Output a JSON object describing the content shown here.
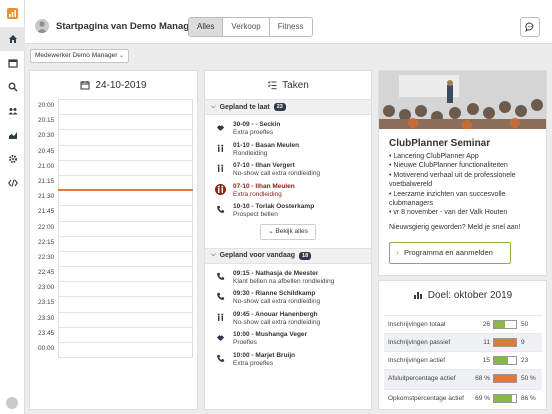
{
  "header": {
    "title": "Startpagina van Demo Manager",
    "tabs": [
      {
        "label": "Alles",
        "active": true
      },
      {
        "label": "Verkoop",
        "active": false
      },
      {
        "label": "Fitness",
        "active": false
      }
    ]
  },
  "sidebar": {
    "items": [
      {
        "icon": "home-icon",
        "active": true
      },
      {
        "icon": "calendar-icon",
        "active": false
      },
      {
        "icon": "search-icon",
        "active": false
      },
      {
        "icon": "users-icon",
        "active": false
      },
      {
        "icon": "chart-icon",
        "active": false
      },
      {
        "icon": "gear-icon",
        "active": false
      },
      {
        "icon": "code-icon",
        "active": false
      }
    ]
  },
  "employee_select": {
    "value": "Medewerker Demo Manager"
  },
  "calendar": {
    "date": "24-10-2019",
    "times": [
      "20:00",
      "20:15",
      "20:30",
      "20:45",
      "21:00",
      "21:15",
      "21:30",
      "21:45",
      "22:00",
      "22:15",
      "22:30",
      "22:45",
      "23:00",
      "23:15",
      "23:30",
      "23:45",
      "00:00"
    ],
    "now_after_slot": 5
  },
  "tasks": {
    "title": "Taken",
    "sections": [
      {
        "title": "Gepland te laat",
        "count": "23",
        "items": [
          {
            "title": "30-09 - - Seckin",
            "subtitle": "Extra proefles",
            "icon": "handshake-icon",
            "overdue": false
          },
          {
            "title": "01-10 - Basan Meulen",
            "subtitle": "Rondleiding",
            "icon": "walk-icon",
            "overdue": false
          },
          {
            "title": "07-10 - Ilhan Vergert",
            "subtitle": "No-show call extra rondleiding",
            "icon": "walk-icon",
            "overdue": false
          },
          {
            "title": "07-10 - Ilhan Meulen",
            "subtitle": "Extra rondleiding",
            "icon": "walk-icon",
            "overdue": true
          },
          {
            "title": "10-10 - Torlak Oosterkamp",
            "subtitle": "Prospect bellen",
            "icon": "phone-icon",
            "overdue": false
          }
        ],
        "show_all": "Bekijk alles"
      },
      {
        "title": "Gepland voor vandaag",
        "count": "18",
        "items": [
          {
            "title": "09:15 - Nathasja de Meester",
            "subtitle": "Klant bellen na afbellen rondleiding",
            "icon": "phone-icon",
            "overdue": false
          },
          {
            "title": "09:30 - Rianne Schildkamp",
            "subtitle": "No-show call extra rondleiding",
            "icon": "phone-icon",
            "overdue": false
          },
          {
            "title": "09:45 - Anouar Hanenbergh",
            "subtitle": "No-show call extra rondleiding",
            "icon": "walk-icon",
            "overdue": false
          },
          {
            "title": "10:00 - Mushanga Veger",
            "subtitle": "Proefles",
            "icon": "handshake-icon",
            "overdue": false
          },
          {
            "title": "10:00 - Marjet Bruijn",
            "subtitle": "Extra proefles",
            "icon": "phone-icon",
            "overdue": false
          }
        ]
      }
    ]
  },
  "seminar": {
    "title": "ClubPlanner Seminar",
    "bullets": [
      "• Lancering ClubPlanner App",
      "• Nieuwe ClubPlanner functionaliteiten",
      "• Motiverend verhaal uit de professionele voetbalwereld",
      "• Leerzame inzichten van succesvolle clubmanagers",
      "• vr 8 november - van der Valk Houten"
    ],
    "cta_text": "Nieuwsgierig geworden? Meld je snel aan!",
    "button_label": "Programma en aanmelden"
  },
  "goal": {
    "title": "Doel: oktober 2019",
    "rows": [
      {
        "label": "Inschrijvingen totaal",
        "current": "26",
        "target": "50",
        "fraction": 0.52,
        "color": "#8ab844"
      },
      {
        "label": "Inschrijvingen passief",
        "current": "11",
        "target": "9",
        "fraction": 1.0,
        "color": "#e07a3c"
      },
      {
        "label": "Inschrijvingen actief",
        "current": "15",
        "target": "23",
        "fraction": 0.65,
        "color": "#8ab844"
      },
      {
        "label": "Afsluitpercentage actief",
        "current": "68 %",
        "target": "50 %",
        "fraction": 1.0,
        "color": "#e07a3c"
      },
      {
        "label": "Opkomstpercentage actief",
        "current": "69 %",
        "target": "86 %",
        "fraction": 0.8,
        "color": "#8ab844"
      }
    ]
  },
  "colors": {
    "accent_green": "#87b43c",
    "accent_orange": "#e07a3c",
    "overdue_red": "#8c2418",
    "badge_dark": "#2f3b4c"
  }
}
